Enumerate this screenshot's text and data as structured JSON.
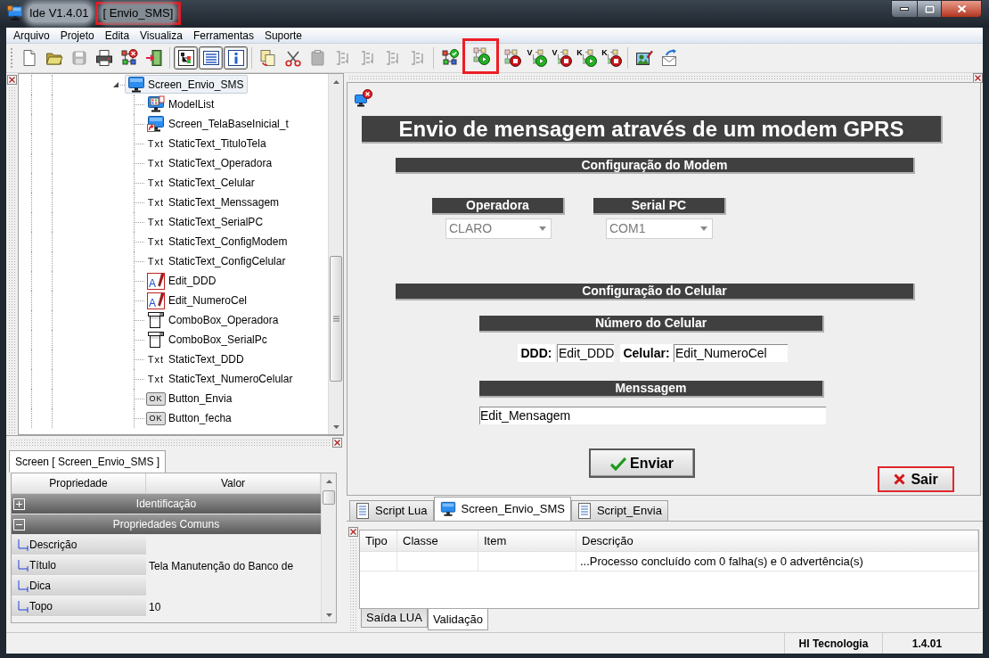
{
  "window": {
    "title": "Ide V1.4.01",
    "document": {
      "label": "[ Envio_SMS]",
      "marked": true
    }
  },
  "menu": [
    {
      "label": "Arquivo"
    },
    {
      "label": "Projeto"
    },
    {
      "label": "Edita"
    },
    {
      "label": "Visualiza"
    },
    {
      "label": "Ferramentas"
    },
    {
      "label": "Suporte"
    }
  ],
  "toolbar": [
    {
      "items": [
        {
          "kind": "new",
          "disabled": false,
          "pressed": false,
          "marked": false
        },
        {
          "kind": "open",
          "disabled": false,
          "pressed": false,
          "marked": false
        },
        {
          "kind": "save",
          "disabled": true,
          "pressed": false,
          "marked": false
        },
        {
          "kind": "print",
          "disabled": false,
          "pressed": false,
          "marked": false
        },
        {
          "kind": "network_remove",
          "disabled": false,
          "pressed": false,
          "marked": false
        },
        {
          "kind": "exit",
          "disabled": false,
          "pressed": false,
          "marked": false
        }
      ]
    },
    {
      "items": [
        {
          "kind": "tree_view",
          "disabled": false,
          "pressed": true,
          "marked": false
        },
        {
          "kind": "list_view",
          "disabled": false,
          "pressed": true,
          "marked": false
        },
        {
          "kind": "info",
          "disabled": false,
          "pressed": true,
          "marked": false
        }
      ]
    },
    {
      "items": [
        {
          "kind": "copy",
          "disabled": false,
          "pressed": false,
          "marked": false
        },
        {
          "kind": "cut",
          "disabled": false,
          "pressed": false,
          "marked": false
        },
        {
          "kind": "paste",
          "disabled": true,
          "pressed": false,
          "marked": false
        },
        {
          "kind": "arrange",
          "disabled": true,
          "pressed": false,
          "marked": false
        },
        {
          "kind": "arrange",
          "disabled": true,
          "pressed": false,
          "marked": false
        },
        {
          "kind": "arrange",
          "disabled": true,
          "pressed": false,
          "marked": false
        },
        {
          "kind": "arrange",
          "disabled": true,
          "pressed": false,
          "marked": false
        }
      ]
    },
    {
      "items": [
        {
          "kind": "network_check",
          "disabled": false,
          "pressed": false,
          "marked": false
        },
        {
          "kind": "run",
          "disabled": false,
          "pressed": false,
          "marked": true
        },
        {
          "kind": "stop",
          "disabled": false,
          "pressed": false,
          "marked": false
        },
        {
          "kind": "run",
          "letter": "V",
          "disabled": false,
          "pressed": false,
          "marked": false
        },
        {
          "kind": "stop",
          "letter": "V",
          "disabled": false,
          "pressed": false,
          "marked": false
        },
        {
          "kind": "run",
          "letter": "K",
          "disabled": false,
          "pressed": false,
          "marked": false
        },
        {
          "kind": "stop",
          "letter": "K",
          "disabled": false,
          "pressed": false,
          "marked": false
        }
      ]
    },
    {
      "items": [
        {
          "kind": "image_edit",
          "disabled": false,
          "pressed": false,
          "marked": false
        },
        {
          "kind": "send_mail",
          "disabled": false,
          "pressed": false,
          "marked": false
        }
      ]
    }
  ],
  "tree": [
    {
      "label": "Screen_Envio_SMS",
      "kind": "screen",
      "expanded": true,
      "selected": true,
      "children": [
        {
          "label": "ModelList",
          "kind": "model_list",
          "selected": false
        },
        {
          "label": "Screen_TelaBaseInicial_t",
          "kind": "screen_link",
          "selected": false
        },
        {
          "label": "StaticText_TituloTela",
          "kind": "static_text",
          "badge": "Txt",
          "selected": false
        },
        {
          "label": "StaticText_Operadora",
          "kind": "static_text",
          "badge": "Txt",
          "selected": false
        },
        {
          "label": "StaticText_Celular",
          "kind": "static_text",
          "badge": "Txt",
          "selected": false
        },
        {
          "label": "StaticText_Menssagem",
          "kind": "static_text",
          "badge": "Txt",
          "selected": false
        },
        {
          "label": "StaticText_SerialPC",
          "kind": "static_text",
          "badge": "Txt",
          "selected": false
        },
        {
          "label": "StaticText_ConfigModem",
          "kind": "static_text",
          "badge": "Txt",
          "selected": false
        },
        {
          "label": "StaticText_ConfigCelular",
          "kind": "static_text",
          "badge": "Txt",
          "selected": false
        },
        {
          "label": "Edit_DDD",
          "kind": "edit",
          "badge": "A",
          "selected": false
        },
        {
          "label": "Edit_NumeroCel",
          "kind": "edit",
          "badge": "A",
          "selected": false
        },
        {
          "label": "ComboBox_Operadora",
          "kind": "combo_box",
          "selected": false
        },
        {
          "label": "ComboBox_SerialPc",
          "kind": "combo_box",
          "selected": false
        },
        {
          "label": "StaticText_DDD",
          "kind": "static_text",
          "badge": "Txt",
          "selected": false
        },
        {
          "label": "StaticText_NumeroCelular",
          "kind": "static_text",
          "badge": "Txt",
          "selected": false
        },
        {
          "label": "Button_Envia",
          "kind": "button",
          "badge": "OK",
          "selected": false
        },
        {
          "label": "Button_fecha",
          "kind": "button",
          "badge": "OK",
          "selected": false
        }
      ]
    }
  ],
  "properties": {
    "tab": "Screen [ Screen_Envio_SMS ]",
    "columns": [
      "Propriedade",
      "Valor"
    ],
    "categories": [
      {
        "label": "Identificação",
        "expanded": false
      },
      {
        "label": "Propriedades Comuns",
        "expanded": true,
        "children": [
          {
            "name": "Descrição"
          },
          {
            "name": "Título",
            "value": "Tela Manutenção do Banco de"
          },
          {
            "name": "Dica"
          },
          {
            "name": "Topo",
            "value": "10"
          }
        ]
      }
    ]
  },
  "form": {
    "title": "Envio de mensagem através de um modem GPRS",
    "modem_header": "Configuração do Modem",
    "operator": {
      "label": "Operadora",
      "value": "CLARO",
      "disabled": true
    },
    "serial": {
      "label": "Serial PC",
      "value": "COM1",
      "disabled": true
    },
    "phone_header": "Configuração do Celular",
    "number_header": "Número do Celular",
    "ddd": {
      "label": "DDD:",
      "value": "Edit_DDD"
    },
    "cell": {
      "label": "Celular:",
      "value": "Edit_NumeroCel"
    },
    "message_header": "Menssagem",
    "message": {
      "value": "Edit_Mensagem"
    },
    "buttons": [
      {
        "kind": "confirm",
        "label": "Enviar"
      },
      {
        "kind": "cancel",
        "label": "Sair"
      }
    ]
  },
  "doc_tabs": [
    {
      "label": "Script Lua",
      "kind": "script",
      "selected": false
    },
    {
      "label": "Screen_Envio_SMS",
      "kind": "screen",
      "selected": true
    },
    {
      "label": "Script_Envia",
      "kind": "script",
      "selected": false
    }
  ],
  "output": {
    "columns": [
      "Tipo",
      "Classe",
      "Item",
      "Descrição"
    ],
    "rows": [
      {
        "description": "...Processo concluído com 0 falha(s) e 0 advertência(s)"
      }
    ],
    "tabs": [
      {
        "label": "Saída LUA",
        "selected": false
      },
      {
        "label": "Validação",
        "selected": true
      }
    ]
  },
  "status_bar": [
    "HI Tecnologia",
    "1.4.01"
  ]
}
